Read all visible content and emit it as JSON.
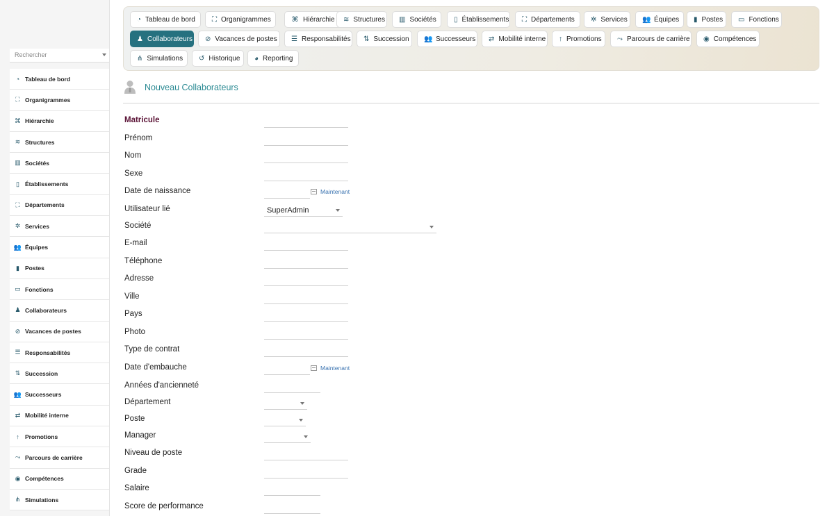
{
  "sidebar": {
    "search_placeholder": "Rechercher",
    "items": [
      {
        "label": "Tableau de bord",
        "icon": "dashboard-icon"
      },
      {
        "label": "Organigrammes",
        "icon": "sitemap-icon"
      },
      {
        "label": "Hiérarchie",
        "icon": "hierarchy-icon"
      },
      {
        "label": "Structures",
        "icon": "layers-icon"
      },
      {
        "label": "Sociétés",
        "icon": "industry-icon"
      },
      {
        "label": "Établissements",
        "icon": "building-icon"
      },
      {
        "label": "Départements",
        "icon": "sitemap-icon"
      },
      {
        "label": "Services",
        "icon": "cogs-icon"
      },
      {
        "label": "Équipes",
        "icon": "users-icon"
      },
      {
        "label": "Postes",
        "icon": "id-badge-icon"
      },
      {
        "label": "Fonctions",
        "icon": "briefcase-icon"
      },
      {
        "label": "Collaborateurs",
        "icon": "user-tie-icon"
      },
      {
        "label": "Vacances de postes",
        "icon": "user-slash-icon"
      },
      {
        "label": "Responsabilités",
        "icon": "list-icon"
      },
      {
        "label": "Succession",
        "icon": "sort-icon"
      },
      {
        "label": "Successeurs",
        "icon": "user-group-icon"
      },
      {
        "label": "Mobilité interne",
        "icon": "exchange-icon"
      },
      {
        "label": "Promotions",
        "icon": "arrow-up-icon"
      },
      {
        "label": "Parcours de carrière",
        "icon": "route-icon"
      },
      {
        "label": "Compétences",
        "icon": "brain-icon"
      },
      {
        "label": "Simulations",
        "icon": "project-diagram-icon"
      }
    ]
  },
  "tabs": [
    {
      "label": "Tableau de bord",
      "icon": "dashboard-icon"
    },
    {
      "label": "Organigrammes",
      "icon": "sitemap-icon"
    },
    {
      "label": "Hiérarchie",
      "icon": "hierarchy-icon"
    },
    {
      "label": "Structures",
      "icon": "layers-icon"
    },
    {
      "label": "Sociétés",
      "icon": "industry-icon"
    },
    {
      "label": "Établissements",
      "icon": "building-icon"
    },
    {
      "label": "Départements",
      "icon": "sitemap-icon"
    },
    {
      "label": "Services",
      "icon": "cogs-icon"
    },
    {
      "label": "Équipes",
      "icon": "users-icon"
    },
    {
      "label": "Postes",
      "icon": "id-badge-icon"
    },
    {
      "label": "Fonctions",
      "icon": "briefcase-icon"
    },
    {
      "label": "Collaborateurs",
      "icon": "user-tie-icon",
      "active": true
    },
    {
      "label": "Vacances de postes",
      "icon": "user-slash-icon"
    },
    {
      "label": "Responsabilités",
      "icon": "list-icon"
    },
    {
      "label": "Succession",
      "icon": "sort-icon"
    },
    {
      "label": "Successeurs",
      "icon": "user-group-icon"
    },
    {
      "label": "Mobilité interne",
      "icon": "exchange-icon"
    },
    {
      "label": "Promotions",
      "icon": "arrow-up-icon"
    },
    {
      "label": "Parcours de carrière",
      "icon": "route-icon"
    },
    {
      "label": "Compétences",
      "icon": "brain-icon"
    },
    {
      "label": "Simulations",
      "icon": "project-diagram-icon"
    },
    {
      "label": "Historique",
      "icon": "history-icon"
    },
    {
      "label": "Reporting",
      "icon": "pie-chart-icon"
    }
  ],
  "page": {
    "title": "Nouveau Collaborateurs",
    "title_icon": "user-avatar-icon"
  },
  "form": {
    "now_label": "Maintenant",
    "fields": {
      "matricule": {
        "label": "Matricule",
        "value": ""
      },
      "prenom": {
        "label": "Prénom",
        "value": ""
      },
      "nom": {
        "label": "Nom",
        "value": ""
      },
      "sexe": {
        "label": "Sexe",
        "value": ""
      },
      "date_naissance": {
        "label": "Date de naissance",
        "value": ""
      },
      "utilisateur_lie": {
        "label": "Utilisateur lié",
        "value": "SuperAdmin"
      },
      "societe": {
        "label": "Société",
        "value": ""
      },
      "email": {
        "label": "E-mail",
        "value": ""
      },
      "telephone": {
        "label": "Téléphone",
        "value": ""
      },
      "adresse": {
        "label": "Adresse",
        "value": ""
      },
      "ville": {
        "label": "Ville",
        "value": ""
      },
      "pays": {
        "label": "Pays",
        "value": ""
      },
      "photo": {
        "label": "Photo",
        "value": ""
      },
      "type_contrat": {
        "label": "Type de contrat",
        "value": ""
      },
      "date_embauche": {
        "label": "Date d'embauche",
        "value": ""
      },
      "annees_anciennete": {
        "label": "Années d'ancienneté",
        "value": ""
      },
      "departement": {
        "label": "Département",
        "value": ""
      },
      "poste": {
        "label": "Poste",
        "value": ""
      },
      "manager": {
        "label": "Manager",
        "value": ""
      },
      "niveau_poste": {
        "label": "Niveau de poste",
        "value": ""
      },
      "grade": {
        "label": "Grade",
        "value": ""
      },
      "salaire": {
        "label": "Salaire",
        "value": ""
      },
      "score_performance": {
        "label": "Score de performance",
        "value": ""
      }
    }
  }
}
